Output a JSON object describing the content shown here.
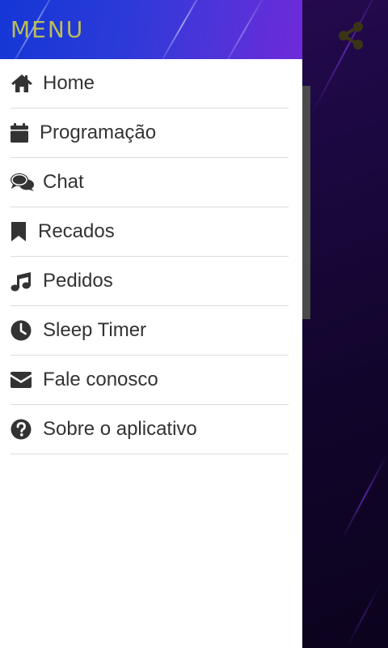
{
  "drawer": {
    "title": "MENU",
    "items": [
      {
        "label": "Home",
        "icon": "home-icon"
      },
      {
        "label": "Programação",
        "icon": "calendar-icon"
      },
      {
        "label": "Chat",
        "icon": "chat-bubbles-icon"
      },
      {
        "label": "Recados",
        "icon": "bookmark-icon"
      },
      {
        "label": "Pedidos",
        "icon": "music-note-icon"
      },
      {
        "label": "Sleep Timer",
        "icon": "clock-icon"
      },
      {
        "label": "Fale conosco",
        "icon": "envelope-icon"
      },
      {
        "label": "Sobre o aplicativo",
        "icon": "question-circle-icon"
      }
    ]
  },
  "app_bar": {
    "share_icon": "share-icon"
  },
  "colors": {
    "header_gradient_start": "#1437d6",
    "header_gradient_end": "#6f2ad8",
    "title_color": "#bdbe55",
    "text_color": "#333333",
    "share_icon_color": "#3b3517"
  }
}
